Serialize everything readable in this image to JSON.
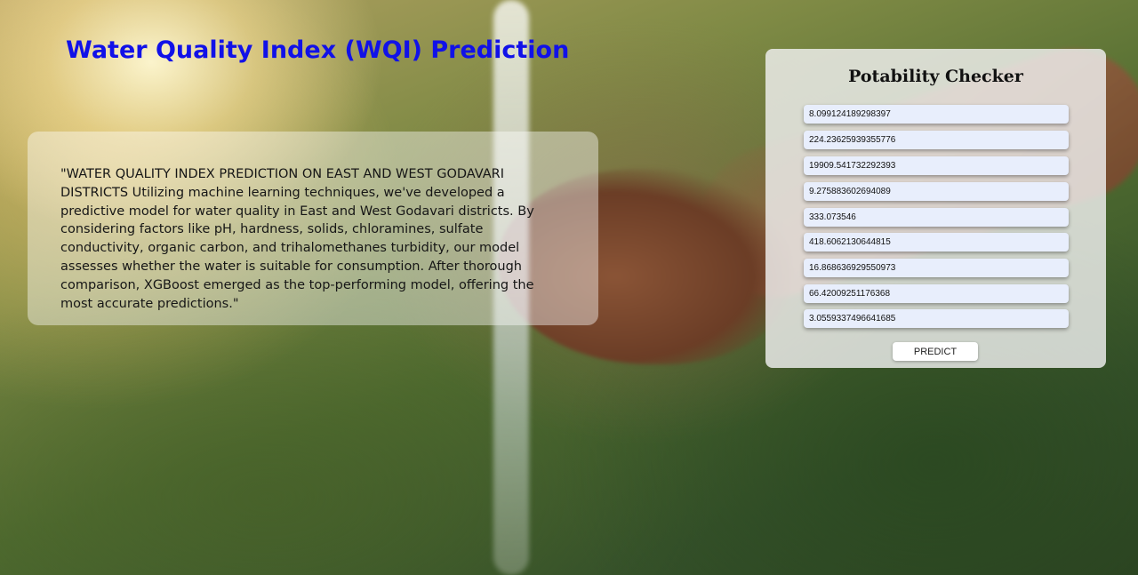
{
  "header": {
    "title": "Water Quality Index (WQI) Prediction"
  },
  "info": {
    "text": "\"WATER QUALITY INDEX PREDICTION ON EAST AND WEST GODAVARI DISTRICTS Utilizing machine learning techniques, we've developed a predictive model for water quality in East and West Godavari districts. By considering factors like pH, hardness, solids, chloramines, sulfate conductivity, organic carbon, and trihalomethanes turbidity, our model assesses whether the water is suitable for consumption. After thorough comparison, XGBoost emerged as the top-performing model, offering the most accurate predictions.\""
  },
  "checker": {
    "title": "Potability Checker",
    "fields": [
      "8.099124189298397",
      "224.23625939355776",
      "19909.541732292393",
      "9.275883602694089",
      "333.073546",
      "418.6062130644815",
      "16.868636929550973",
      "66.42009251176368",
      "3.0559337496641685"
    ],
    "predict_label": "PREDICT"
  },
  "colors": {
    "title": "#1111e8",
    "field_background": "#e8eefc"
  }
}
